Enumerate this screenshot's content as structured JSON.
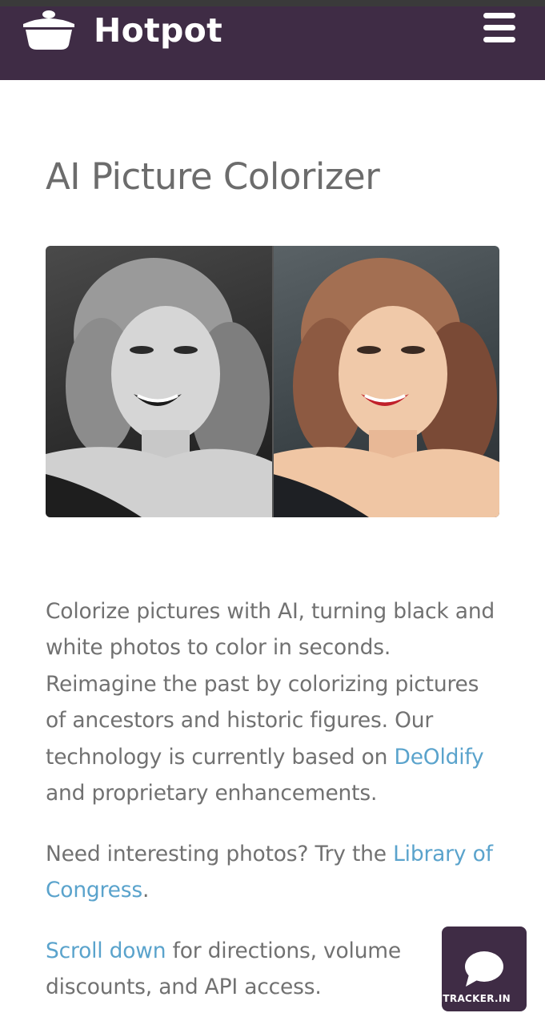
{
  "header": {
    "brand": "Hotpot",
    "logo_icon": "cooking-pot-icon",
    "menu_icon": "hamburger-menu-icon",
    "background_color": "#3f2c45"
  },
  "main": {
    "title": "AI Picture Colorizer",
    "hero_image": {
      "left": "black and white portrait",
      "right": "colorized portrait"
    },
    "paragraph1": {
      "text_before": "Colorize pictures with AI, turning black and white photos to color in seconds. Reimagine the past by colorizing pictures of ancestors and historic figures. Our technology is currently based on ",
      "link": "DeOldify",
      "text_after": " and proprietary enhancements."
    },
    "paragraph2": {
      "text_before": "Need interesting photos? Try the ",
      "link": "Library of Congress",
      "text_after": "."
    },
    "paragraph3": {
      "link": "Scroll down",
      "text_after": " for directions, volume discounts, and API access."
    },
    "link_color": "#5aa3cc",
    "text_color": "#717171"
  },
  "chat": {
    "icon": "chat-bubble-icon"
  },
  "watermark": {
    "text": "TECHTRACKER.IN"
  }
}
